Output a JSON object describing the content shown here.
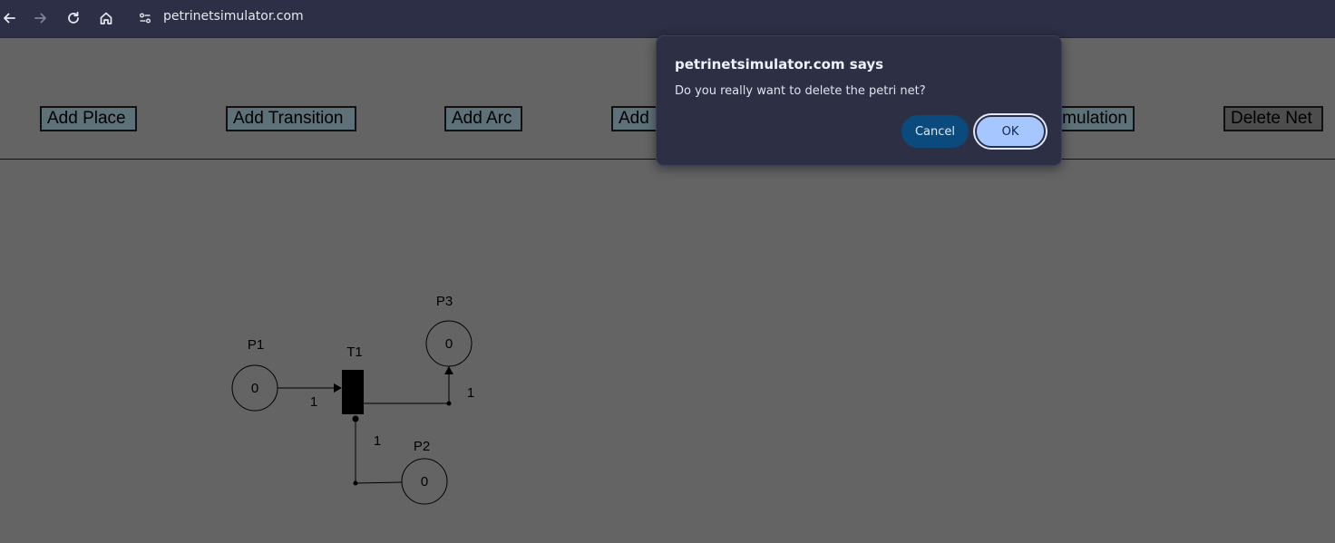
{
  "browser": {
    "url": "petrinetsimulator.com",
    "icons": [
      "back-arrow-icon",
      "forward-arrow-icon",
      "reload-icon",
      "home-icon",
      "site-settings-icon"
    ]
  },
  "toolbar": {
    "add_place": "Add Place",
    "add_transition": "Add Transition",
    "add_arc": "Add Arc",
    "add_hidden": "Add",
    "simulation_partial": "mulation",
    "delete_net": "Delete Net"
  },
  "petri_net": {
    "places": [
      {
        "id": "P1",
        "label": "P1",
        "tokens": "0"
      },
      {
        "id": "P2",
        "label": "P2",
        "tokens": "0"
      },
      {
        "id": "P3",
        "label": "P3",
        "tokens": "0"
      }
    ],
    "transitions": [
      {
        "id": "T1",
        "label": "T1"
      }
    ],
    "arcs": [
      {
        "from": "P1",
        "to": "T1",
        "weight": "1"
      },
      {
        "from": "T1",
        "to": "P3",
        "weight": "1"
      },
      {
        "from": "T1",
        "to": "P2",
        "weight": "1"
      }
    ]
  },
  "dialog": {
    "title": "petrinetsimulator.com says",
    "message": "Do you really want to delete the petri net?",
    "cancel_label": "Cancel",
    "ok_label": "OK"
  },
  "colors": {
    "page_background": "#646464",
    "toolbar_button": "#5e7178",
    "delete_button": "#4d4d4d",
    "chrome_bar": "#2c2f45",
    "dialog_background": "#2d3045",
    "cancel_button": "#0b4a7d",
    "ok_button": "#a6c6ff"
  }
}
